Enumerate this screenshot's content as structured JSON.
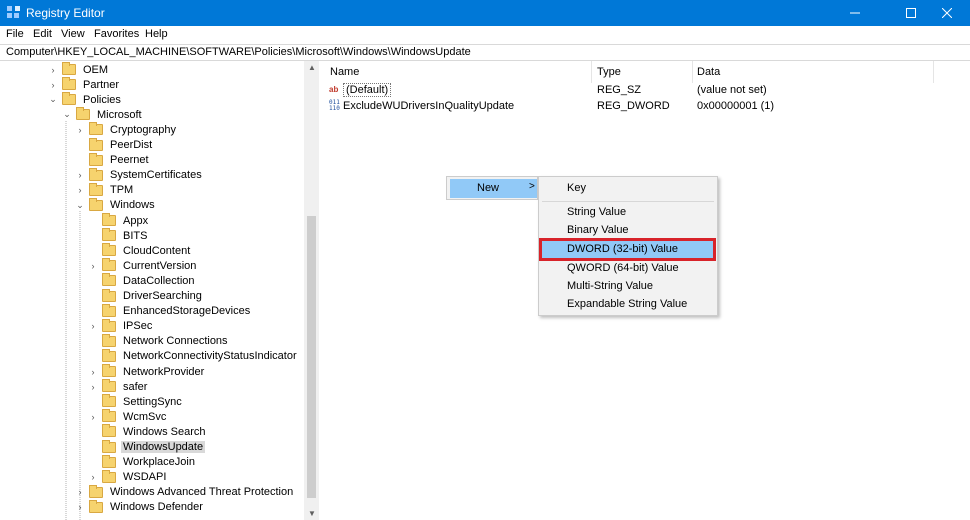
{
  "window": {
    "title": "Registry Editor",
    "accent_color": "#0078d7",
    "controls": {
      "minimize_icon": "minimize-icon",
      "maximize_icon": "maximize-icon",
      "close_icon": "close-icon"
    }
  },
  "menubar": {
    "file": "File",
    "edit": "Edit",
    "view": "View",
    "favorites": "Favorites",
    "help": "Help"
  },
  "address": {
    "path": "Computer\\HKEY_LOCAL_MACHINE\\SOFTWARE\\Policies\\Microsoft\\Windows\\WindowsUpdate"
  },
  "tree": {
    "items": [
      {
        "label": "OEM",
        "expander": ">"
      },
      {
        "label": "Partner",
        "expander": ">"
      },
      {
        "label": "Policies",
        "expander": "v"
      },
      {
        "label": "Microsoft",
        "expander": "v"
      },
      {
        "label": "Cryptography",
        "expander": ">"
      },
      {
        "label": "PeerDist",
        "expander": ""
      },
      {
        "label": "Peernet",
        "expander": ""
      },
      {
        "label": "SystemCertificates",
        "expander": ">"
      },
      {
        "label": "TPM",
        "expander": ">"
      },
      {
        "label": "Windows",
        "expander": "v"
      },
      {
        "label": "Appx",
        "expander": ""
      },
      {
        "label": "BITS",
        "expander": ""
      },
      {
        "label": "CloudContent",
        "expander": ""
      },
      {
        "label": "CurrentVersion",
        "expander": ">"
      },
      {
        "label": "DataCollection",
        "expander": ""
      },
      {
        "label": "DriverSearching",
        "expander": ""
      },
      {
        "label": "EnhancedStorageDevices",
        "expander": ""
      },
      {
        "label": "IPSec",
        "expander": ">"
      },
      {
        "label": "Network Connections",
        "expander": ""
      },
      {
        "label": "NetworkConnectivityStatusIndicator",
        "expander": ""
      },
      {
        "label": "NetworkProvider",
        "expander": ">"
      },
      {
        "label": "safer",
        "expander": ">"
      },
      {
        "label": "SettingSync",
        "expander": ""
      },
      {
        "label": "WcmSvc",
        "expander": ">"
      },
      {
        "label": "Windows Search",
        "expander": ""
      },
      {
        "label": "WindowsUpdate",
        "expander": "",
        "selected": true
      },
      {
        "label": "WorkplaceJoin",
        "expander": ""
      },
      {
        "label": "WSDAPI",
        "expander": ">"
      },
      {
        "label": "Windows Advanced Threat Protection",
        "expander": ">"
      },
      {
        "label": "Windows Defender",
        "expander": ">"
      }
    ]
  },
  "list": {
    "headers": {
      "name": "Name",
      "type": "Type",
      "data": "Data"
    },
    "rows": [
      {
        "icon": "string-value-icon",
        "icon_text": "ab",
        "name": "(Default)",
        "type": "REG_SZ",
        "data": "(value not set)"
      },
      {
        "icon": "binary-value-icon",
        "icon_text": "011 110",
        "name": "ExcludeWUDriversInQualityUpdate",
        "type": "REG_DWORD",
        "data": "0x00000001 (1)"
      }
    ]
  },
  "context_menu": {
    "new": {
      "label": "New",
      "chevron": ">"
    },
    "submenu": {
      "key": "Key",
      "string_value": "String Value",
      "binary_value": "Binary Value",
      "dword_value": "DWORD (32-bit) Value",
      "qword_value": "QWORD (64-bit) Value",
      "multi_string_value": "Multi-String Value",
      "expandable_string_value": "Expandable String Value"
    },
    "highlight_color": "#91c9f7",
    "callout_color": "#d8232a"
  }
}
